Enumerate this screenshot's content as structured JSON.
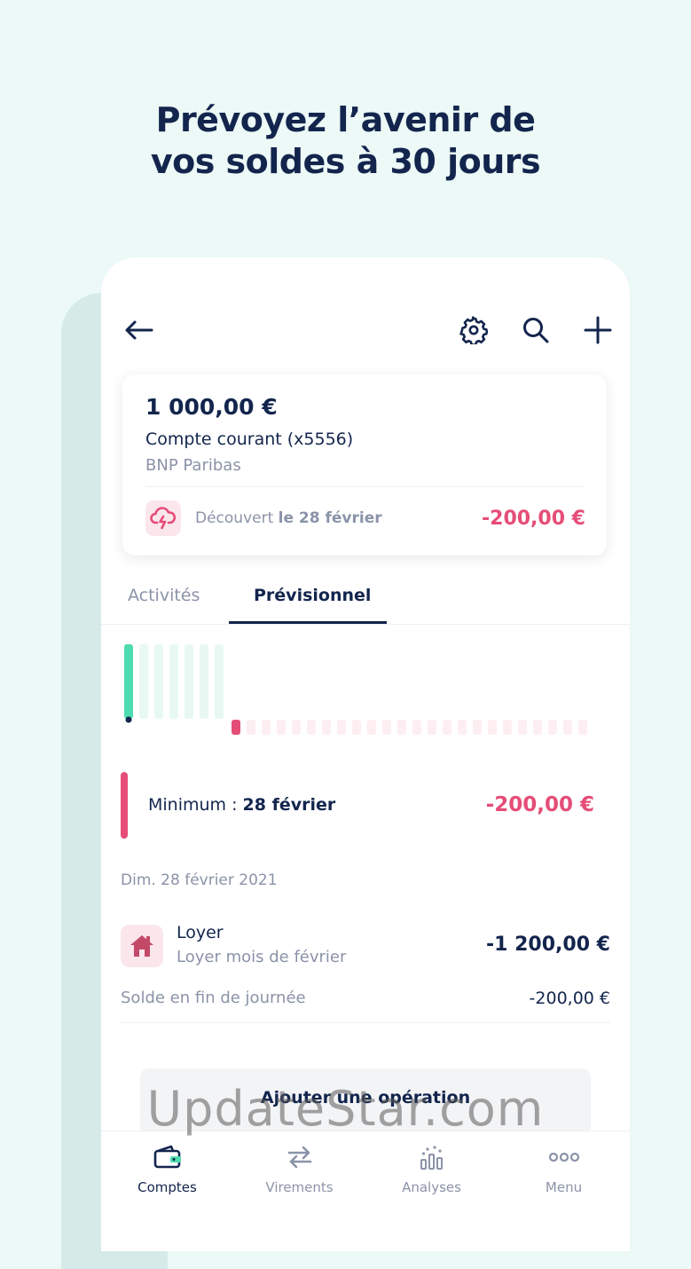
{
  "headline": {
    "line1": "Prévoyez l’avenir de",
    "line2": "vos soldes à 30 jours"
  },
  "toolbar": {
    "back_icon": "arrow-left-icon",
    "settings_icon": "gear-icon",
    "search_icon": "search-icon",
    "add_icon": "plus-icon"
  },
  "account": {
    "balance": "1 000,00 €",
    "name": "Compte courant (x5556)",
    "bank": "BNP Paribas",
    "alert_prefix": "Découvert",
    "alert_date": "le 28 février",
    "alert_amount": "-200,00 €",
    "alert_icon": "cloud-lightning-icon"
  },
  "tabs": {
    "activites": "Activités",
    "previsionnel": "Prévisionnel",
    "active": "previsionnel"
  },
  "forecast_chart": {
    "positive_days": 7,
    "negative_days": 24,
    "positive_color": "#4ddbb0",
    "negative_color": "#e54d77"
  },
  "minimum": {
    "label": "Minimum :",
    "date": "28 février",
    "amount": "-200,00 €"
  },
  "day": {
    "header": "Dim. 28 février 2021",
    "transaction": {
      "title": "Loyer",
      "subtitle": "Loyer mois de février",
      "amount": "-1 200,00 €",
      "icon": "house-icon"
    },
    "end_of_day_label": "Solde en fin de journée",
    "end_of_day_amount": "-200,00 €"
  },
  "add_button": "Ajouter une opération",
  "nav": {
    "items": [
      {
        "label": "Comptes",
        "icon": "wallet-icon",
        "active": true
      },
      {
        "label": "Virements",
        "icon": "transfer-arrows-icon",
        "active": false
      },
      {
        "label": "Analyses",
        "icon": "analytics-icon",
        "active": false
      },
      {
        "label": "Menu",
        "icon": "more-dots-icon",
        "active": false
      }
    ]
  },
  "watermark": "UpdateStar.com",
  "colors": {
    "navy": "#13254d",
    "pink": "#e54d77",
    "mint": "#4ddbb0",
    "background": "#ecf9f6"
  }
}
